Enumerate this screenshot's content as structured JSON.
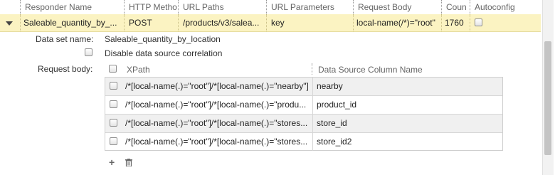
{
  "table": {
    "columns": [
      "Responder Name",
      "HTTP Metho",
      "URL Paths",
      "URL Parameters",
      "Request Body",
      "Coun",
      "Autoconfig"
    ],
    "row": {
      "responder_name": "Saleable_quantity_by_...",
      "http_method": "POST",
      "url_paths": "/products/v3/salea...",
      "url_parameters": "key",
      "request_body": "local-name(/*)=\"root\"",
      "count": "1760"
    }
  },
  "details": {
    "data_set_name_label": "Data set name:",
    "data_set_name_value": "Saleable_quantity_by_location",
    "disable_correlation_label": "Disable data source correlation",
    "request_body_label": "Request body:"
  },
  "body_grid": {
    "xpath_header": "XPath",
    "column_header": "Data Source Column Name",
    "rows": [
      {
        "xpath": "/*[local-name(.)=\"root\"]/*[local-name(.)=\"nearby\"]",
        "column": "nearby"
      },
      {
        "xpath": "/*[local-name(.)=\"root\"]/*[local-name(.)=\"produ...",
        "column": "product_id"
      },
      {
        "xpath": "/*[local-name(.)=\"root\"]/*[local-name(.)=\"stores...",
        "column": "store_id"
      },
      {
        "xpath": "/*[local-name(.)=\"root\"]/*[local-name(.)=\"stores...",
        "column": "store_id2"
      }
    ]
  },
  "actions": {
    "add_icon": "plus-icon",
    "delete_icon": "trash-icon"
  },
  "colors": {
    "selected_row": "#fbf3c2",
    "header_text": "#666666"
  }
}
